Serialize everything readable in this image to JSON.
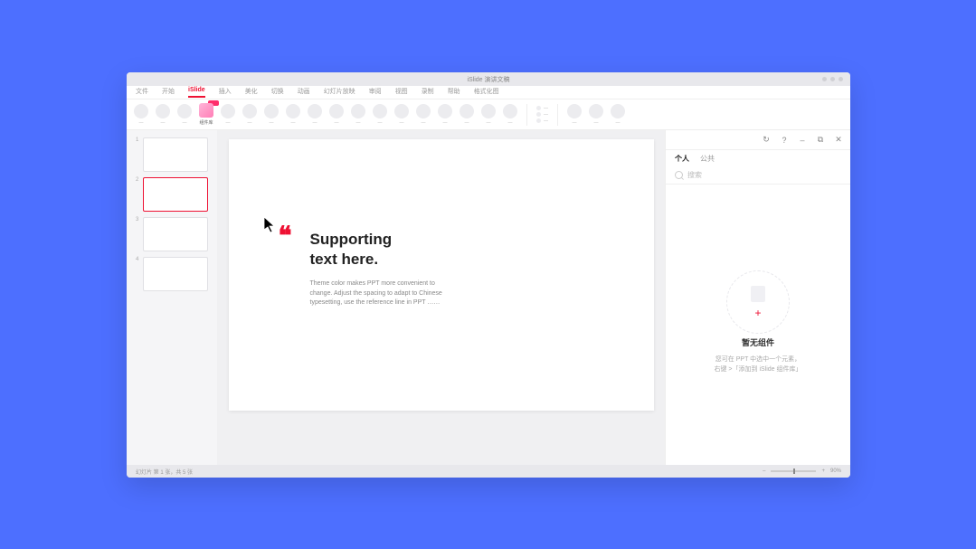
{
  "window": {
    "title": "iSlide 演讲文稿"
  },
  "menu": {
    "items": [
      "文件",
      "开始",
      "iSlide",
      "插入",
      "美化",
      "切换",
      "动画",
      "幻灯片放映",
      "审阅",
      "视图",
      "录制",
      "帮助",
      "格式化图"
    ],
    "active_index": 2
  },
  "ribbon": {
    "highlight_label": "组件库",
    "generic_label": "—"
  },
  "thumbs": {
    "count": 4,
    "selected": 2
  },
  "slide": {
    "title_l1": "Supporting",
    "title_l2": "text here.",
    "body": "Theme color makes PPT more convenient to change. Adjust the spacing to adapt to Chinese typesetting, use the reference line in PPT ……",
    "quote": "❝"
  },
  "panel": {
    "tools": {
      "refresh": "↻",
      "help": "?",
      "minus": "–",
      "popout": "⧉",
      "close": "✕"
    },
    "tabs": {
      "personal": "个人",
      "public": "公共",
      "active": "personal"
    },
    "search_placeholder": "搜索",
    "empty": {
      "doc_icon": "📄",
      "plus": "+",
      "title": "暂无组件",
      "line1": "您可在 PPT 中选中一个元素，",
      "line2": "右键 >「添加到 iSlide 组件库」"
    }
  },
  "status": {
    "left": "幻灯片 第 1 张，共 5 张",
    "zoom_minus": "–",
    "zoom_plus": "+",
    "zoom_pct": "90%"
  }
}
